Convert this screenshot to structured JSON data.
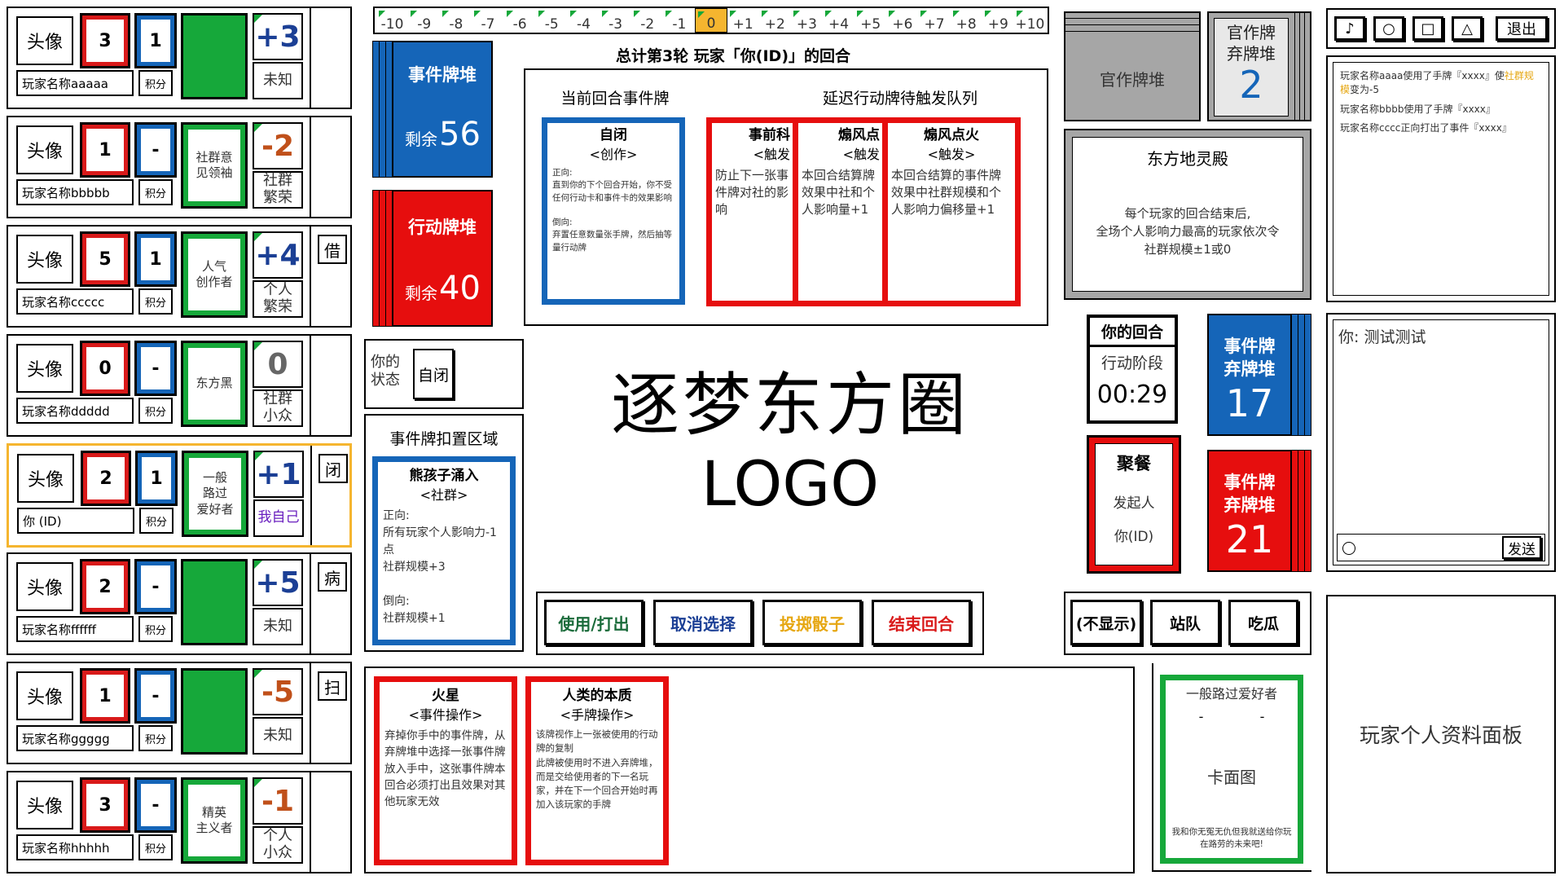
{
  "players": [
    {
      "avatar": "头像",
      "red": "3",
      "blue": "1",
      "role": "",
      "delta": "+3",
      "tag": "未知",
      "name": "玩家名称aaaaa",
      "score": "积分",
      "status": ""
    },
    {
      "avatar": "头像",
      "red": "1",
      "blue": "-",
      "role": "社群意\n见领袖",
      "delta": "-2",
      "tag": "社群\n繁荣",
      "name": "玩家名称bbbbb",
      "score": "积分",
      "status": ""
    },
    {
      "avatar": "头像",
      "red": "5",
      "blue": "1",
      "role": "人气\n创作者",
      "delta": "+4",
      "tag": "个人\n繁荣",
      "name": "玩家名称ccccc",
      "score": "积分",
      "status": "借"
    },
    {
      "avatar": "头像",
      "red": "0",
      "blue": "-",
      "role": "东方黑",
      "delta": "0",
      "tag": "社群\n小众",
      "name": "玩家名称ddddd",
      "score": "积分",
      "status": ""
    },
    {
      "avatar": "头像",
      "red": "2",
      "blue": "1",
      "role": "一般\n路过\n爱好者",
      "delta": "+1",
      "tag": "我自己",
      "name": "你 (ID)",
      "score": "积分",
      "status": "闭"
    },
    {
      "avatar": "头像",
      "red": "2",
      "blue": "-",
      "role": "",
      "delta": "+5",
      "tag": "未知",
      "name": "玩家名称ffffff",
      "score": "积分",
      "status": "病"
    },
    {
      "avatar": "头像",
      "red": "1",
      "blue": "-",
      "role": "",
      "delta": "-5",
      "tag": "未知",
      "name": "玩家名称ggggg",
      "score": "积分",
      "status": "扫"
    },
    {
      "avatar": "头像",
      "red": "3",
      "blue": "-",
      "role": "精英\n主义者",
      "delta": "-1",
      "tag": "个人\n小众",
      "name": "玩家名称hhhhh",
      "score": "积分",
      "status": ""
    }
  ],
  "track": {
    "ticks": [
      "-10",
      "-9",
      "-8",
      "-7",
      "-6",
      "-5",
      "-4",
      "-3",
      "-2",
      "-1",
      "0",
      "+1",
      "+2",
      "+3",
      "+4",
      "+5",
      "+6",
      "+7",
      "+8",
      "+9",
      "+10"
    ],
    "current": "0"
  },
  "round_title": "总计第3轮  玩家「你(ID)」的回合",
  "event_deck": {
    "title": "事件牌堆",
    "remain_label": "剩余",
    "count": "56"
  },
  "action_deck": {
    "title": "行动牌堆",
    "remain_label": "剩余",
    "count": "40"
  },
  "current_event": {
    "header": "当前回合事件牌",
    "name": "自闭",
    "sub": "<创作>",
    "body": "正向:\n直到你的下个回合开始，你不受任何行动卡和事件卡的效果影响\n\n倒向:\n弃置任意数量张手牌，然后抽等量行动牌"
  },
  "delay_queue": {
    "header": "延迟行动牌待触发队列",
    "cards": [
      {
        "name": "事前科",
        "sub": "<触发",
        "body": "防止下一张事件牌对社的影响"
      },
      {
        "name": "煽风点",
        "sub": "<触发",
        "body": "本回合结算牌效果中社和个人影响量+1"
      },
      {
        "name": "煽风点火",
        "sub": "<触发>",
        "body": "本回合结算的事件牌效果中社群规模和个人影响力偏移量+1"
      }
    ]
  },
  "official_deck": {
    "label": "官作牌堆"
  },
  "official_discard": {
    "title": "官作牌\n弃牌堆",
    "count": "2"
  },
  "location": {
    "name": "东方地灵殿",
    "body": "每个玩家的回合结束后,\n全场个人影响力最高的玩家依次令\n社群规模±1或0"
  },
  "toolbar": {
    "music": "♪",
    "circle": "○",
    "square": "□",
    "triangle": "△",
    "quit": "退出"
  },
  "log": [
    {
      "text": "玩家名称aaaa使用了手牌『xxxx』使",
      "hl": "社群规模",
      "tail": "变为-5"
    },
    {
      "text": "玩家名称bbbb使用了手牌『xxxx』",
      "hl": "",
      "tail": ""
    },
    {
      "text": "玩家名称cccc正向打出了事件『xxxx』",
      "hl": "",
      "tail": ""
    }
  ],
  "my_state": {
    "label": "你的\n状态",
    "value": "自闭"
  },
  "logo": {
    "title": "逐梦东方圈",
    "sub": "LOGO"
  },
  "your_turn": {
    "title": "你的回合",
    "phase": "行动阶段",
    "timer": "00:29"
  },
  "event_discard_blue": {
    "title": "事件牌\n弃牌堆",
    "count": "17"
  },
  "event_discard_red": {
    "title": "事件牌\n弃牌堆",
    "count": "21"
  },
  "party": {
    "title": "聚餐",
    "initiator_label": "发起人",
    "initiator": "你(ID)"
  },
  "chat": {
    "message": "你: 测试测试",
    "send": "发送"
  },
  "deduct": {
    "header": "事件牌扣置区域",
    "name": "熊孩子涌入",
    "sub": "<社群>",
    "body": "正向:\n所有玩家个人影响力-1点\n社群规模+3\n\n倒向:\n社群规模+1"
  },
  "actions": {
    "play": "使用/打出",
    "cancel": "取消选择",
    "dice": "投掷骰子",
    "end": "结束回合"
  },
  "stance": {
    "hide": "(不显示)",
    "side": "站队",
    "melon": "吃瓜"
  },
  "hand": [
    {
      "name": "火星",
      "sub": "<事件操作>",
      "body": "弃掉你手中的事件牌，从弃牌堆中选择一张事件牌放入手中，这张事件牌本回合必须打出且效果对其他玩家无效"
    },
    {
      "name": "人类的本质",
      "sub": "<手牌操作>",
      "body": "该牌视作上一张被使用的行动牌的复制\n此牌被使用时不进入弃牌堆，而是交给使用者的下一名玩家，并在下一个回合开始时再加入该玩家的手牌"
    }
  ],
  "role_card": {
    "name": "一般路过爱好者",
    "dash1": "-",
    "dash2": "-",
    "face": "卡面图",
    "quote": "我和你无冤无仇但我就送给你玩在路劳的未来吧!"
  },
  "profile": {
    "label": "玩家个人资料面板"
  },
  "colors": {
    "red": "#d91a1a",
    "blue": "#1565b8",
    "green": "#16a83a",
    "gold": "#f5b52f",
    "grey": "#a6a6a6"
  }
}
